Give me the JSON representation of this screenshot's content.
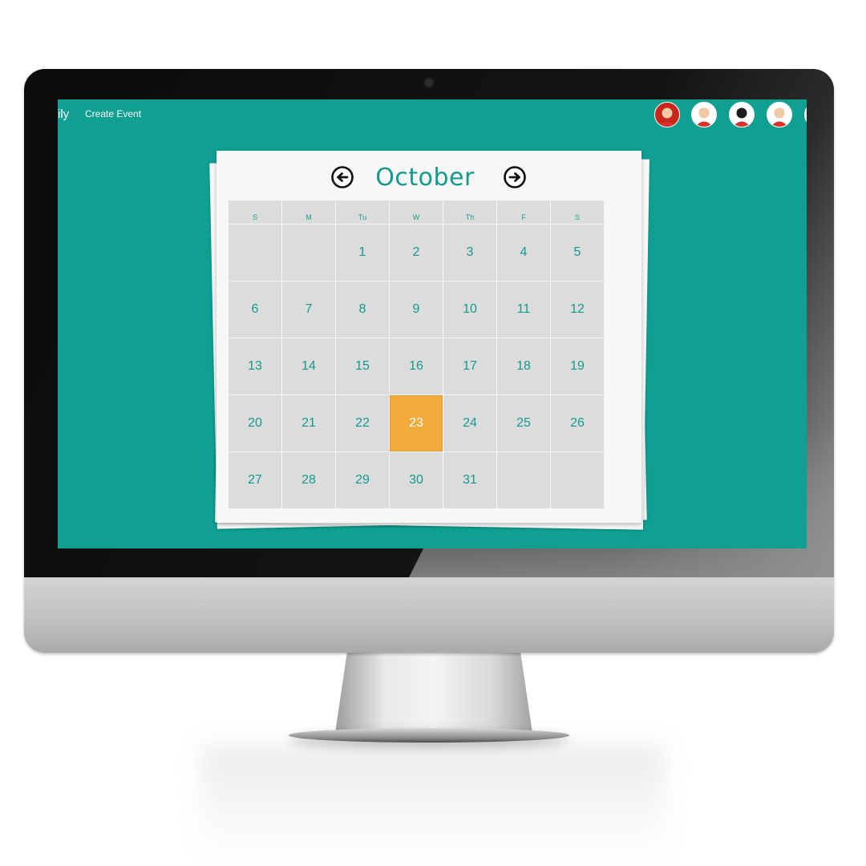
{
  "nav": {
    "brand": "ily",
    "create_event": "Create Event"
  },
  "users": [
    {
      "name": "red-suit-avatar",
      "bg": "#c8261b",
      "face": "#f1c9a5"
    },
    {
      "name": "hero-avatar",
      "bg": "#ffffff",
      "face": "#f1c9a5"
    },
    {
      "name": "masked-avatar",
      "bg": "#ffffff",
      "face": "#1b1b1b"
    },
    {
      "name": "kid-hero-avatar",
      "bg": "#ffffff",
      "face": "#f1c9a5"
    }
  ],
  "calendar": {
    "month": "October",
    "weekdays": [
      "S",
      "M",
      "Tu",
      "W",
      "Th",
      "F",
      "S"
    ],
    "weeks": [
      [
        "",
        "",
        "1",
        "2",
        "3",
        "4",
        "5"
      ],
      [
        "6",
        "7",
        "8",
        "9",
        "10",
        "11",
        "12"
      ],
      [
        "13",
        "14",
        "15",
        "16",
        "17",
        "18",
        "19"
      ],
      [
        "20",
        "21",
        "22",
        "23",
        "24",
        "25",
        "26"
      ],
      [
        "27",
        "28",
        "29",
        "30",
        "31",
        "",
        ""
      ]
    ],
    "selected_day": "23",
    "prev_icon": "arrow-left-circle-icon",
    "next_icon": "arrow-right-circle-icon"
  },
  "colors": {
    "screen_bg": "#0fa092",
    "accent": "#129b8d",
    "selected": "#f2aa3a",
    "cell": "#dcdcdc"
  }
}
